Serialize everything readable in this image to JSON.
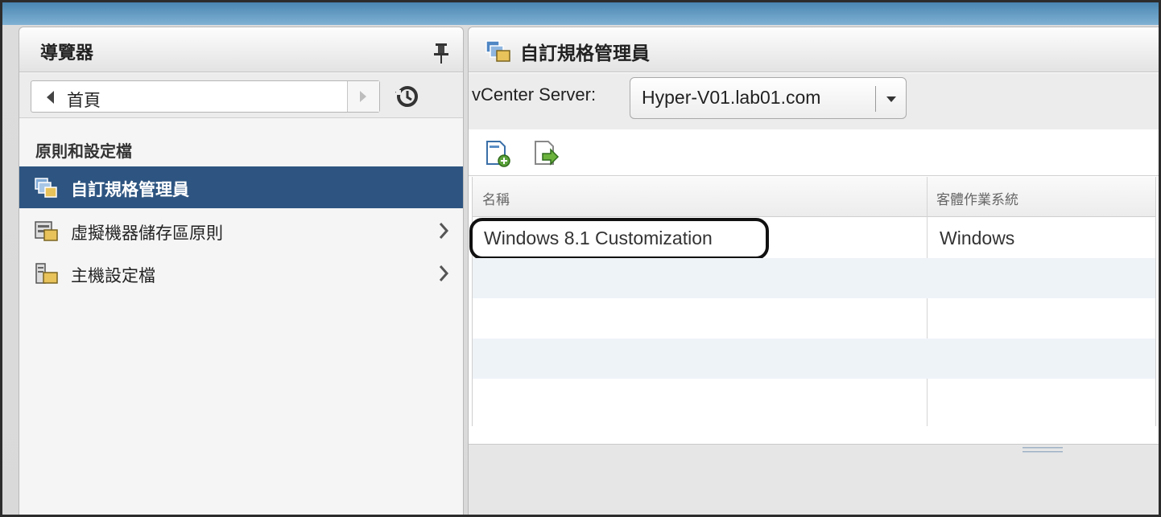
{
  "navigator": {
    "title": "導覽器",
    "home_label": "首頁",
    "section_title": "原則和設定檔",
    "items": [
      {
        "label": "自訂規格管理員",
        "icon": "customization-spec-icon",
        "selected": true
      },
      {
        "label": "虛擬機器儲存區原則",
        "icon": "vm-storage-policy-icon",
        "selected": false
      },
      {
        "label": "主機設定檔",
        "icon": "host-profile-icon",
        "selected": false
      }
    ]
  },
  "main": {
    "title": "自訂規格管理員",
    "vcenter_label": "vCenter Server:",
    "vcenter_value": "Hyper-V01.lab01.com",
    "toolbar": [
      {
        "icon": "new-spec-icon"
      },
      {
        "icon": "import-spec-icon"
      }
    ],
    "columns": [
      "名稱",
      "客體作業系統"
    ],
    "rows": [
      {
        "name": "Windows 8.1 Customization",
        "guest_os": "Windows"
      }
    ]
  },
  "colors": {
    "selected_bg": "#2e5581",
    "row_alt": "#eef3f8",
    "header_top": "#4a86b2"
  }
}
